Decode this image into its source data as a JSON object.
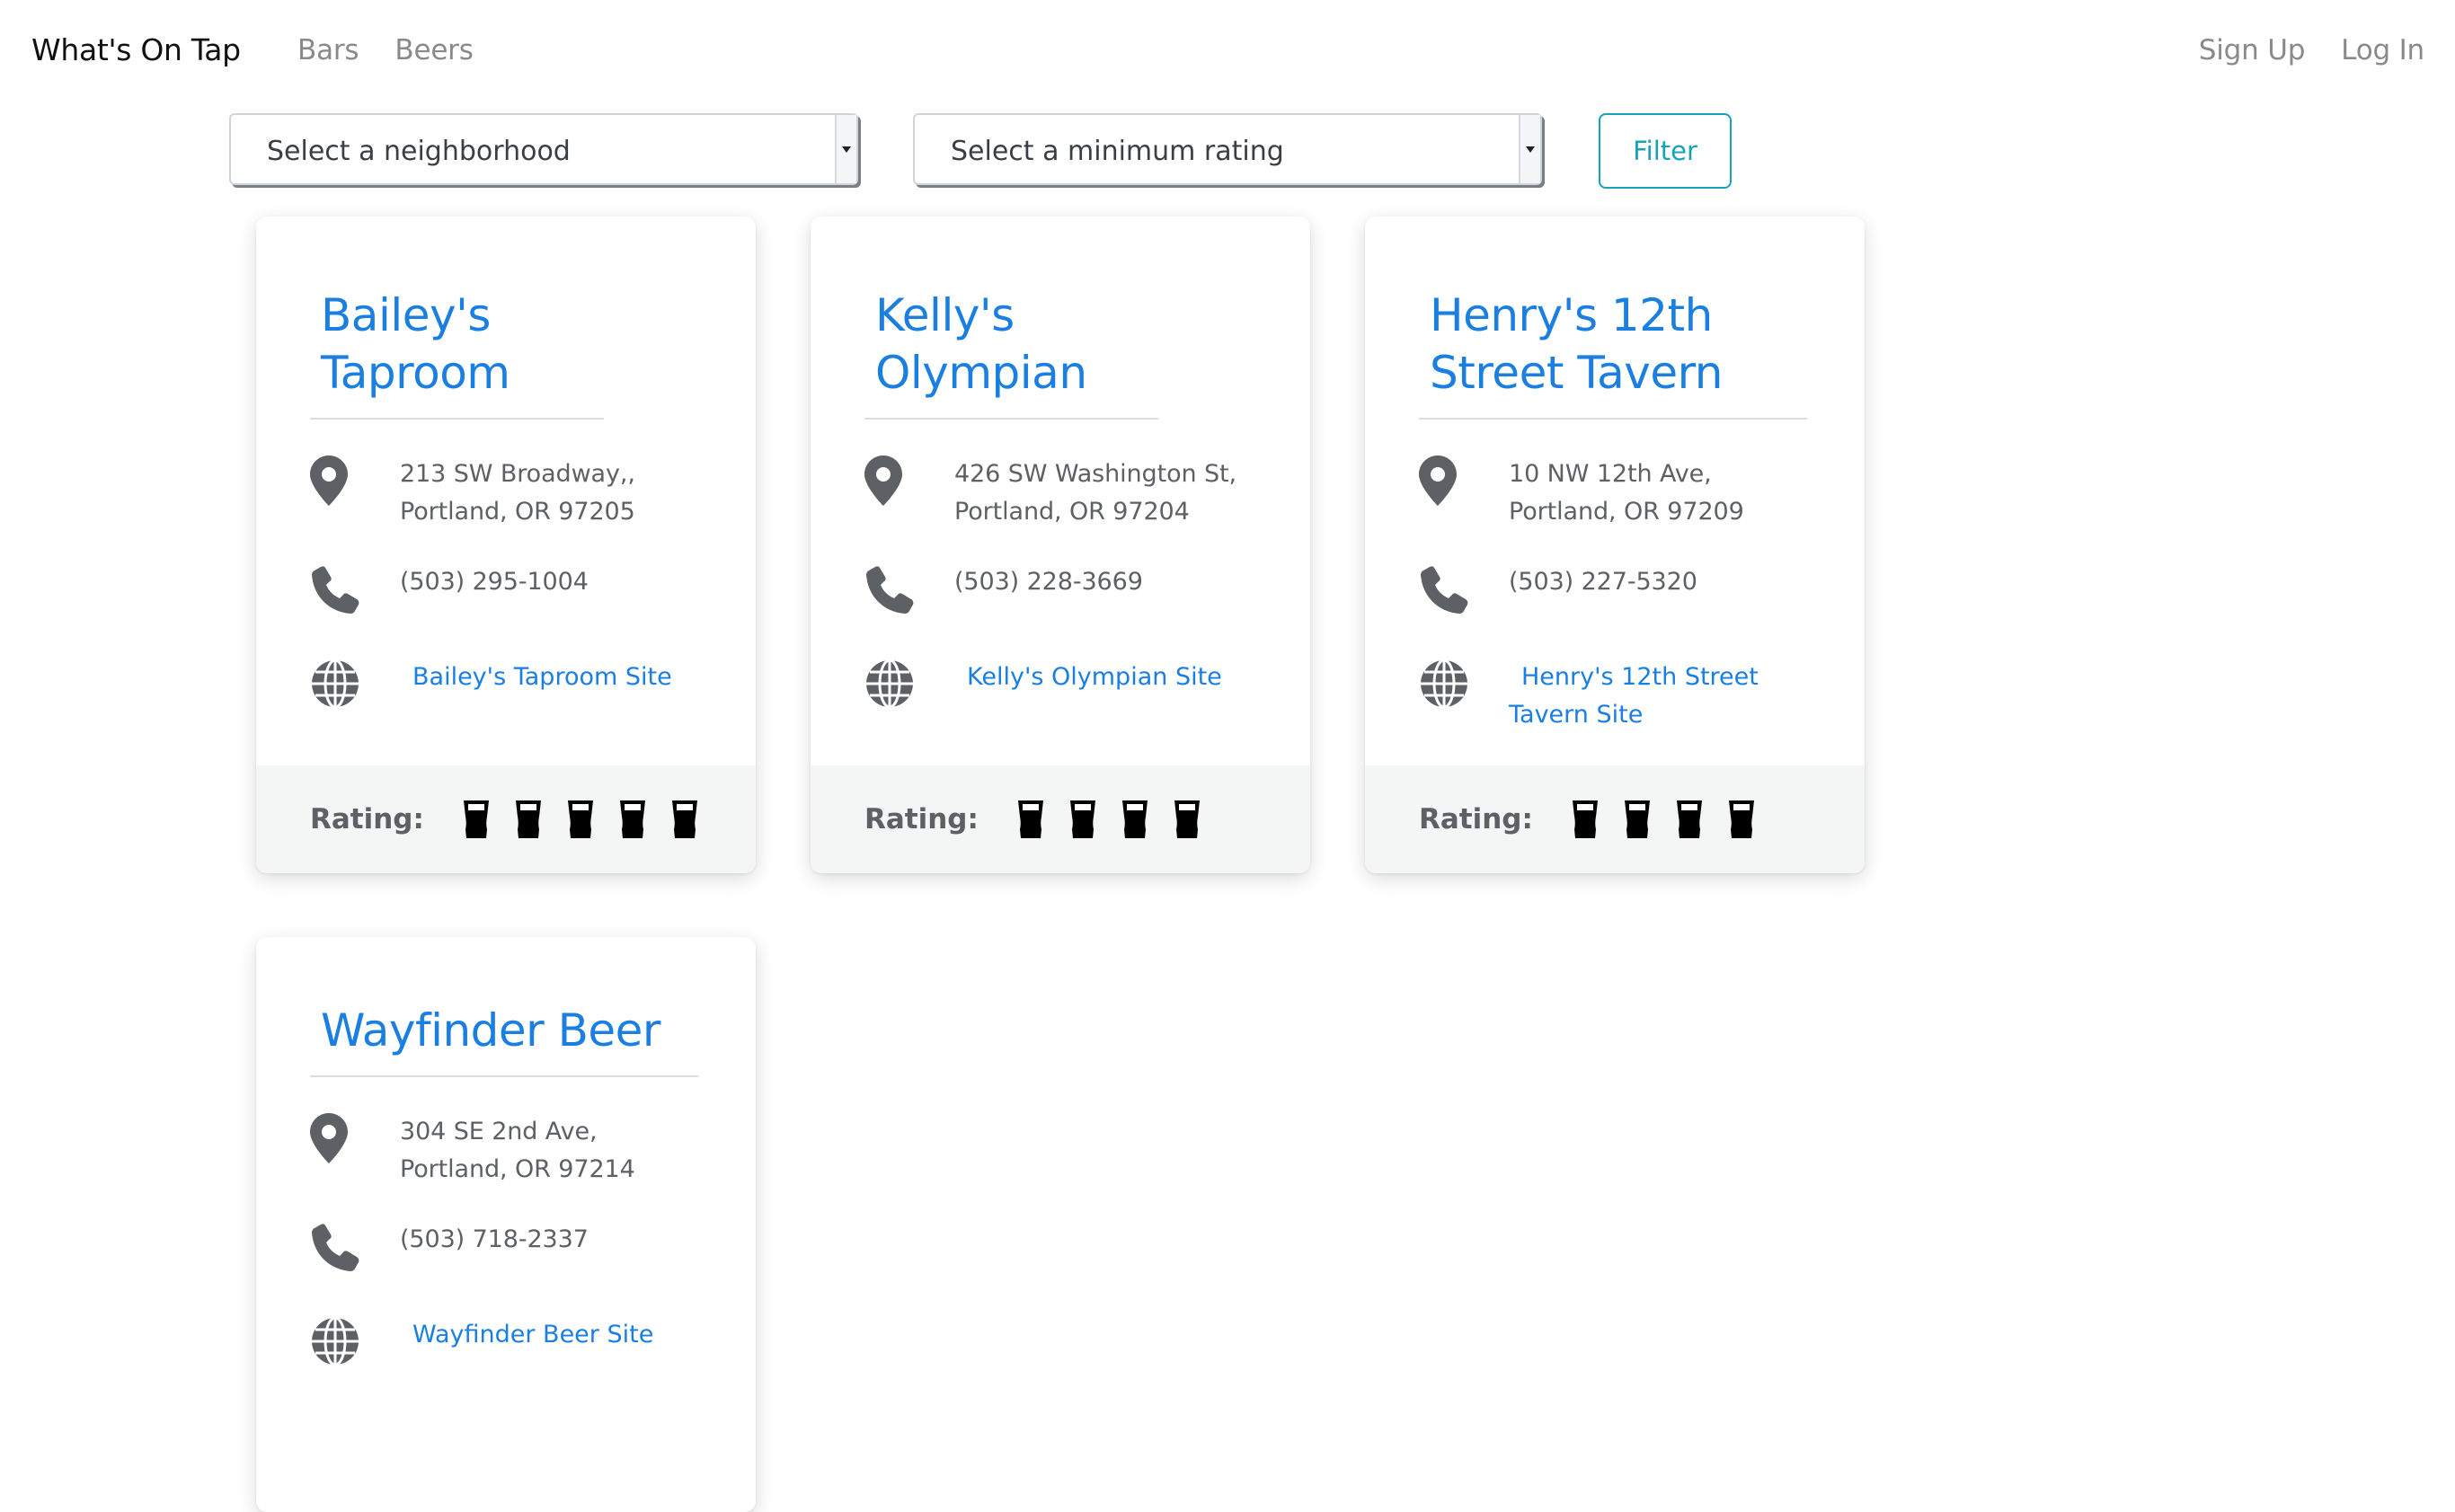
{
  "nav": {
    "brand": "What's On Tap",
    "links": [
      "Bars",
      "Beers"
    ],
    "right_links": [
      "Sign Up",
      "Log In"
    ]
  },
  "filters": {
    "neighborhood_placeholder": "Select a neighborhood",
    "rating_placeholder": "Select a minimum rating",
    "filter_label": "Filter"
  },
  "colors": {
    "accent": "#1a7fe0",
    "filter_button": "#17a2b8",
    "icon": "#5d6166"
  },
  "icons": {
    "address": "map-pin-icon",
    "phone": "phone-icon",
    "site": "globe-icon",
    "rating": "pint-glass-icon"
  },
  "rating_label": "Rating:",
  "bars": [
    {
      "name": "Bailey's Taproom",
      "address": "213 SW Broadway,, Portland, OR 97205",
      "phone": "(503) 295-1004",
      "site": "Bailey's Taproom Site",
      "rating": 5
    },
    {
      "name": "Kelly's Olympian",
      "address": "426 SW Washington St, Portland, OR 97204",
      "phone": "(503) 228-3669",
      "site": "Kelly's Olympian Site",
      "rating": 4
    },
    {
      "name": "Henry's 12th Street Tavern",
      "address": "10 NW 12th Ave, Portland, OR 97209",
      "phone": "(503) 227-5320",
      "site": "Henry's 12th Street Tavern Site",
      "rating": 4
    },
    {
      "name": "Wayfinder Beer",
      "address": "304 SE 2nd Ave, Portland, OR 97214",
      "phone": "(503) 718-2337",
      "site": "Wayfinder Beer Site"
    }
  ]
}
